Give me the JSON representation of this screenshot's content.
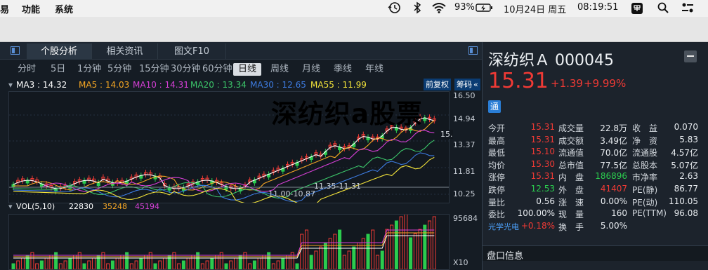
{
  "menubar": {
    "items": [
      "易",
      "功能",
      "系统"
    ],
    "status_right": {
      "battery": "93%",
      "date": "10月24日 周五",
      "time": "08:19:51"
    }
  },
  "tabs": [
    {
      "label": "个股分析",
      "active": true
    },
    {
      "label": "相关资讯",
      "active": false
    },
    {
      "label": "图文F10",
      "active": false
    }
  ],
  "periods": [
    {
      "label": "分时"
    },
    {
      "label": "5日"
    },
    {
      "label": "1分钟"
    },
    {
      "label": "5分钟"
    },
    {
      "label": "15分钟"
    },
    {
      "label": "30分钟"
    },
    {
      "label": "60分钟"
    },
    {
      "label": "日线",
      "active": true
    },
    {
      "label": "周线"
    },
    {
      "label": "月线"
    },
    {
      "label": "季线"
    },
    {
      "label": "年线"
    }
  ],
  "ma": {
    "ma3": "MA3 : 14.32",
    "ma5": "MA5 : 14.03",
    "ma10": "MA10 : 14.31",
    "ma20": "MA20 : 13.34",
    "ma30": "MA30 : 12.65",
    "ma55": "MA55 : 11.99"
  },
  "fuquan": "前复权",
  "chouma": "筹码",
  "watermark": "深纺织a股票",
  "price_axis": [
    "16.50",
    "14.94",
    "13.37",
    "11.81",
    "10.25"
  ],
  "annotations": {
    "range1": "11.00-10.87",
    "range2": "11.35-11.31",
    "last": "15."
  },
  "vol": {
    "label": "VOL(5,10)",
    "v1": "22830",
    "v2": "35248",
    "v3": "45194",
    "axis_top": "95684",
    "axis_bottom": "X10"
  },
  "stock": {
    "name": "深纺织Ａ",
    "code": "000045",
    "price": "15.31",
    "change": "+1.39",
    "change_pct": "+9.99%",
    "badge": "通"
  },
  "quote": [
    [
      "今开",
      "15.31",
      "成交量",
      "22.8万",
      "收　益",
      "0.070"
    ],
    [
      "最高",
      "15.31",
      "成交额",
      "3.49亿",
      "净　资",
      "5.83"
    ],
    [
      "最低",
      "15.10",
      "流通值",
      "70.0亿",
      "流通股",
      "4.57亿"
    ],
    [
      "均价",
      "15.30",
      "总市值",
      "77.5亿",
      "总股本",
      "5.07亿"
    ],
    [
      "涨停",
      "15.31",
      "内　盘",
      "186896",
      "市净率",
      "2.63"
    ],
    [
      "跌停",
      "12.53",
      "外　盘",
      "41407",
      "PE(静)",
      "86.77"
    ],
    [
      "量比",
      "0.56",
      "涨　速",
      "0.00%",
      "PE(动)",
      "110.05"
    ],
    [
      "委比",
      "100.00%",
      "现　量",
      "160",
      "PE(TTM)",
      "96.08"
    ],
    [
      "光学光电",
      "+0.18%",
      "换　手",
      "5.00%",
      "",
      ""
    ]
  ],
  "orderbook_title": "盘口信息",
  "colors": {
    "up": "#f03a35",
    "down": "#2bcc4e",
    "ma3": "#ffffff",
    "ma5": "#f5a623",
    "ma10": "#d63fd6",
    "ma20": "#3cc66a",
    "ma30": "#3d7be0",
    "ma55": "#f3e33a"
  }
}
